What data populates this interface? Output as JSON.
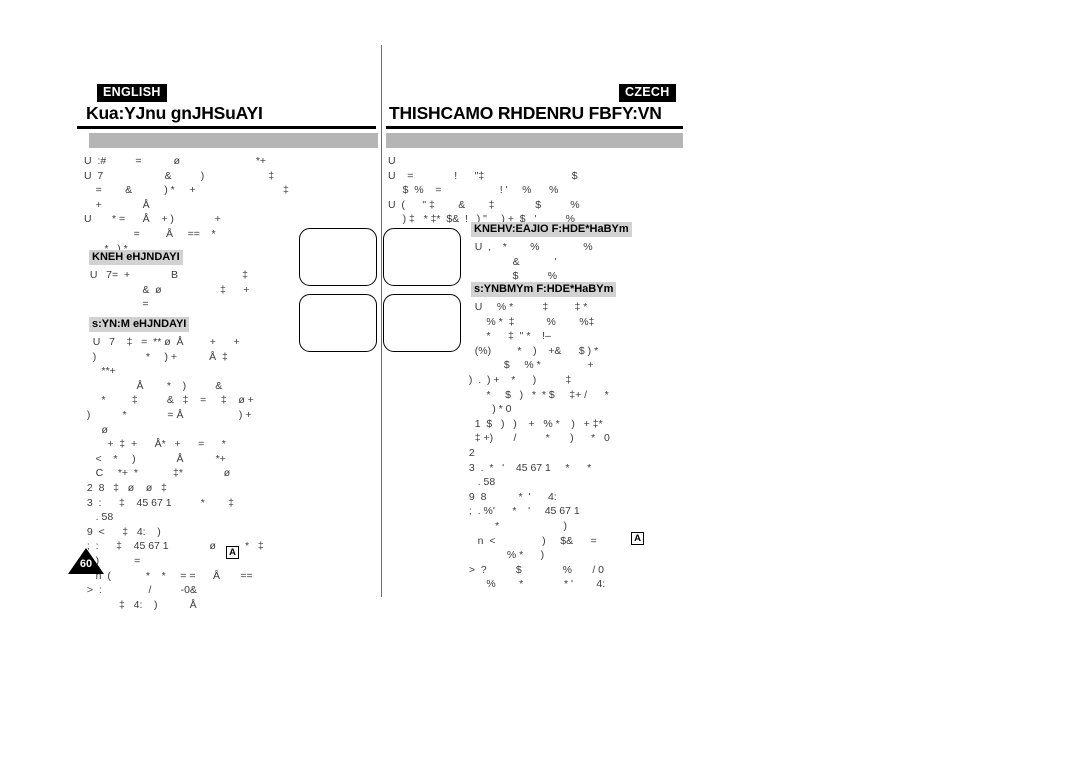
{
  "document": {
    "page_number": "60"
  },
  "left": {
    "language_badge": "ENGLISH",
    "title": "Kua:YJnu gnJHSuAYI",
    "intro_text": "U  :#          =           ø                          *+\nU  7                     &          )                      ‡\n    =        &           ) *     +                              ‡\n    +              Å\nU       * =      Å    + )              +\n                 =         Å     ==    *\n       *   ) *",
    "section1_head": "KNEH eHJNDAYI",
    "section1_text": "  U   7=  +              B                      ‡\n                    &  ø                    ‡      +\n                    =",
    "section2_head": "s:YN:M eHJNDAYI",
    "section2_text": "   U   7    ‡   =  ** ø  Å         +      +\n   )                 *     ) +           Å  ‡\n      **+\n                  Å        *    )          &\n      *         ‡          &   ‡    =     ‡    ø +\n )           *              = Å                   ) +\n      ø\n        +  ‡  +      Å*   +      =      *\n    <    *     )              Å           *+\n    C     *+  *            ‡*              ø\n 2  8   ‡   ø    ø   ‡\n 3  :      ‡    45 67 1          *        ‡\n    . 58\n 9  <      ‡   4:    )\n ;  :      ‡    45 67 1              ø          *   ‡\n    )            =\n    n  (            *    *     = =      Å       ==\n >  :                /          -0&\n            ‡   4:    )           Å"
  },
  "right": {
    "language_badge": "CZECH",
    "title": "THISHCAMO RHDENRU FBFY:VN",
    "intro_text": "U\nU    =              !      \"‡                              $\n     $  %    =                    ! '     %      %\nU  (      \" ‡        &        ‡              $          %\n     ) ‡   * ‡*  $&  !   ) \"     ) +  $   '          %",
    "section1_head": "KNEHV:EAJIO F:HDE*HaBYm",
    "section1_text": "   U  ,    *        %               %\n                &            '\n                $          %",
    "section2_head": "s:YNBMYm F:HDE*HaBYm",
    "section2_text": "   U     % *          ‡         ‡ *\n       % *  ‡           %        %‡\n       *      ‡  \" *    !–\n   (%)         *    )    +&      $ ) *\n             $     % *                +\n )  .  ) +    *      )          ‡\n       *     $   )   *  * $     ‡+ /      *\n         ) * 0\n   1  $   )   )    +   % *    )   + ‡*\n   ‡ +)       /          *       )      *   0\n 2\n 3  .  *   '    45 67 1     *      *\n    . 58\n 9  8           *  '      4:\n ;  . %'      *    '     45 67 1\n          *                      )\n    n  <                )     $&      =\n              % *      )\n >  ?          $              %       / 0\n       %        *              * '        4:"
  },
  "figures": {
    "boxes": [
      {
        "id": "fig-top-left"
      },
      {
        "id": "fig-top-right"
      },
      {
        "id": "fig-bottom-left"
      },
      {
        "id": "fig-bottom-right"
      }
    ]
  },
  "markers": {
    "boxed_a_label": "A"
  },
  "colors": {
    "grey_bar": "#b5b5b5",
    "sub_head_bg": "#d2d2d2",
    "badge_bg": "#000000",
    "rule": "#000000",
    "divider": "#6d6d6d"
  }
}
